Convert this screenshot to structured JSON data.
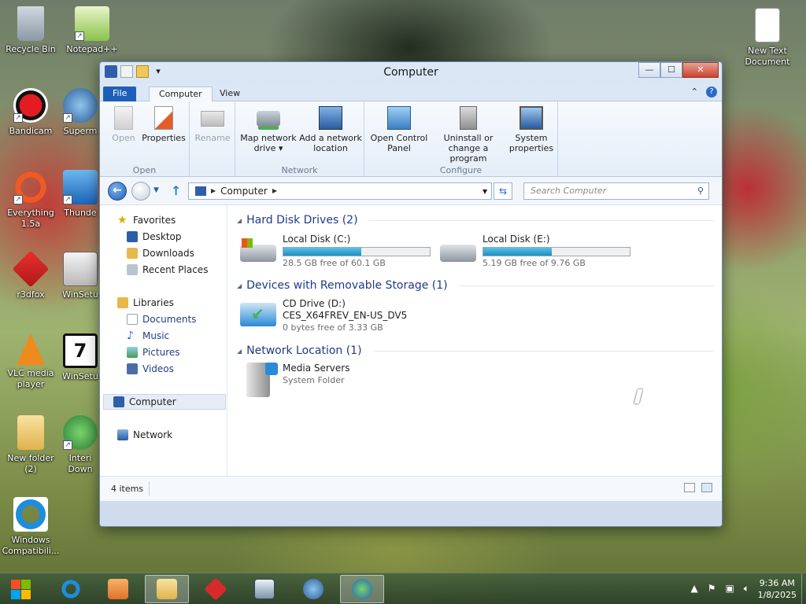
{
  "desktop": {
    "icons": [
      {
        "label": "Recycle Bin"
      },
      {
        "label": "Notepad++"
      },
      {
        "label": "Bandicam"
      },
      {
        "label": "Superm"
      },
      {
        "label": "Everything 1.5a"
      },
      {
        "label": "Thunde"
      },
      {
        "label": "r3dfox"
      },
      {
        "label": "WinSetu"
      },
      {
        "label": "VLC media player"
      },
      {
        "label": "WinSetu"
      },
      {
        "label": "New folder (2)"
      },
      {
        "label": "Interi Down"
      },
      {
        "label": "Windows Compatibili..."
      },
      {
        "label": "New Text Document"
      }
    ]
  },
  "window": {
    "title": "Computer",
    "caption": {
      "minimize": "—",
      "maximize": "☐",
      "close": "✕"
    },
    "ribbon_tabs": {
      "file": "File",
      "computer": "Computer",
      "view": "View"
    },
    "ribbon": {
      "groups": {
        "open": "Open",
        "network": "Network",
        "configure": "Configure"
      },
      "buttons": {
        "open": "Open",
        "properties": "Properties",
        "rename": "Rename",
        "map_network_drive": "Map network drive ▾",
        "add_network_location": "Add a network location",
        "open_control_panel": "Open Control Panel",
        "uninstall": "Uninstall or change a program",
        "system_properties": "System properties"
      }
    },
    "address": {
      "path": "Computer",
      "search_placeholder": "Search Computer"
    },
    "nav_pane": {
      "favorites": "Favorites",
      "desktop": "Desktop",
      "downloads": "Downloads",
      "recent_places": "Recent Places",
      "libraries": "Libraries",
      "documents": "Documents",
      "music": "Music",
      "pictures": "Pictures",
      "videos": "Videos",
      "computer": "Computer",
      "network": "Network"
    },
    "groups": {
      "hard_disk": {
        "title": "Hard Disk Drives (2)",
        "drives": [
          {
            "name": "Local Disk (C:)",
            "free": "28.5 GB free of 60.1 GB",
            "used_fraction": 0.53
          },
          {
            "name": "Local Disk (E:)",
            "free": "5.19 GB free of 9.76 GB",
            "used_fraction": 0.47
          }
        ]
      },
      "removable": {
        "title": "Devices with Removable Storage (1)",
        "drive": {
          "name": "CD Drive (D:)",
          "label": "CES_X64FREV_EN-US_DV5",
          "free": "0 bytes free of 3.33 GB"
        }
      },
      "network_location": {
        "title": "Network Location (1)",
        "item": {
          "name": "Media Servers",
          "type": "System Folder"
        }
      }
    },
    "status": {
      "items": "4 items"
    }
  },
  "taskbar": {
    "clock": {
      "time": "9:36 AM",
      "date": "1/8/2025"
    },
    "apps": [
      "internet-explorer",
      "media-player",
      "file-explorer",
      "r3dfox",
      "app-window",
      "browser",
      "thunder"
    ]
  },
  "colors": {
    "accent": "#1f5fb8",
    "bar_fill": "#1f8fc2",
    "link": "#1e3f86"
  }
}
